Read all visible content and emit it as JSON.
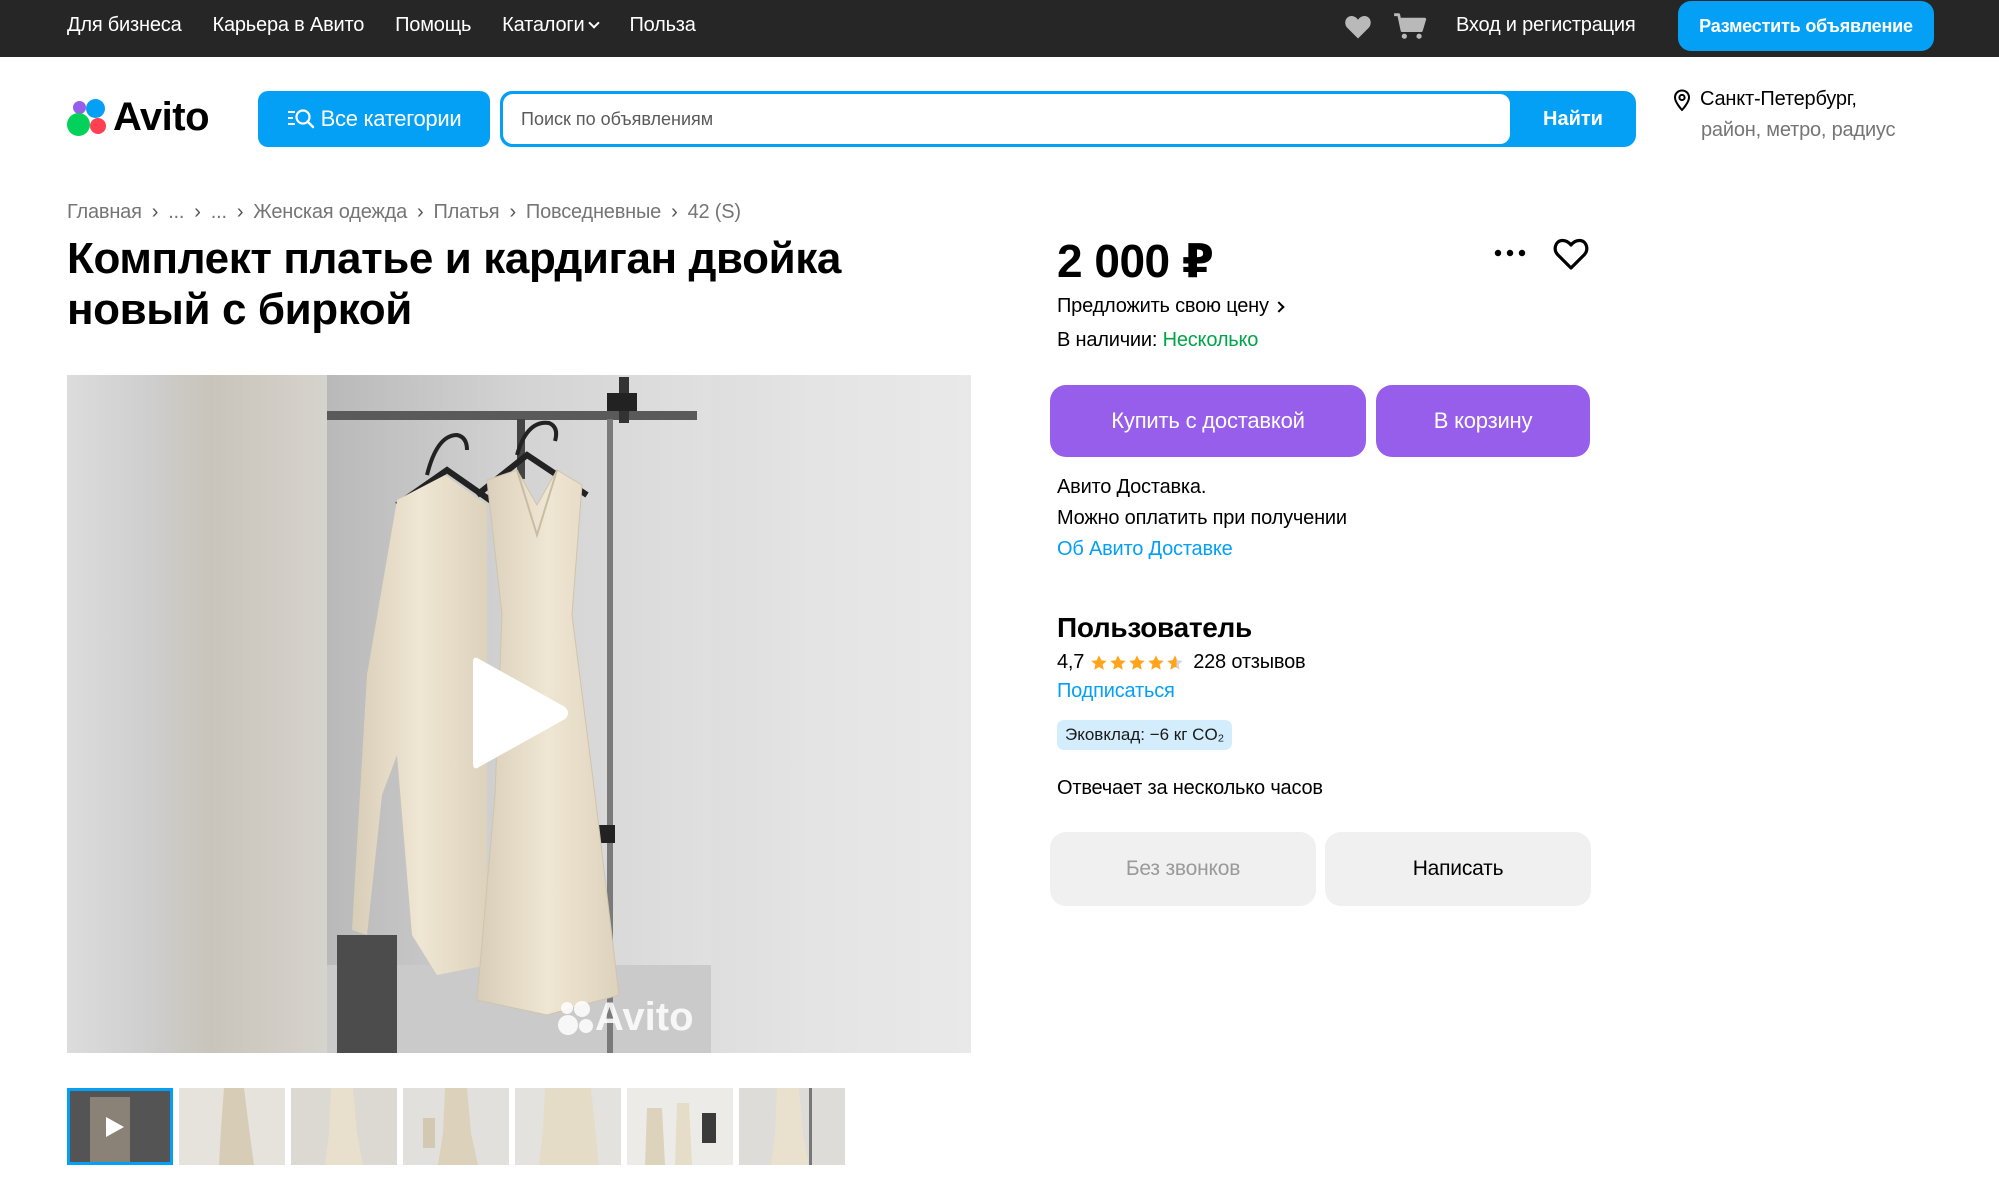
{
  "topbar": {
    "nav": [
      "Для бизнеса",
      "Карьера в Авито",
      "Помощь",
      "Каталоги",
      "Польза"
    ],
    "login": "Вход и регистрация",
    "post_button": "Разместить объявление"
  },
  "header": {
    "logo_text": "Avito",
    "categories_button": "Все категории",
    "search_placeholder": "Поиск по объявлениям",
    "search_button": "Найти",
    "location_city": "Санкт-Петербург,",
    "location_sub": "район, метро, радиус"
  },
  "breadcrumb": [
    "Главная",
    "...",
    "...",
    "Женская одежда",
    "Платья",
    "Повседневные",
    "42 (S)"
  ],
  "listing": {
    "title": "Комплект платье и кардиган двойка новый с биркой",
    "price": "2 000 ₽",
    "offer_price": "Предложить свою цену",
    "stock_label": "В наличии:",
    "stock_value": "Несколько",
    "buy_button": "Купить с доставкой",
    "cart_button": "В корзину",
    "delivery_line1": "Авито Доставка.",
    "delivery_line2": "Можно оплатить при получении",
    "delivery_link": "Об Авито Доставке",
    "watermark": "Avito"
  },
  "seller": {
    "name": "Пользователь",
    "rating": "4,7",
    "stars": 4.7,
    "reviews": "228 отзывов",
    "subscribe": "Подписаться",
    "eco": "Эковклад: −6 кг CO₂",
    "responds": "Отвечает за несколько часов",
    "no_calls_button": "Без звонков",
    "write_button": "Написать"
  },
  "colors": {
    "accent_blue": "#04a0f5",
    "purple": "#965eeb",
    "green": "#02a44a",
    "topbar": "#262626"
  },
  "icons": [
    "heart-icon",
    "cart-icon",
    "search-icon",
    "location-pin-icon",
    "more-icon",
    "favorite-heart-icon",
    "play-icon",
    "star-icon"
  ]
}
